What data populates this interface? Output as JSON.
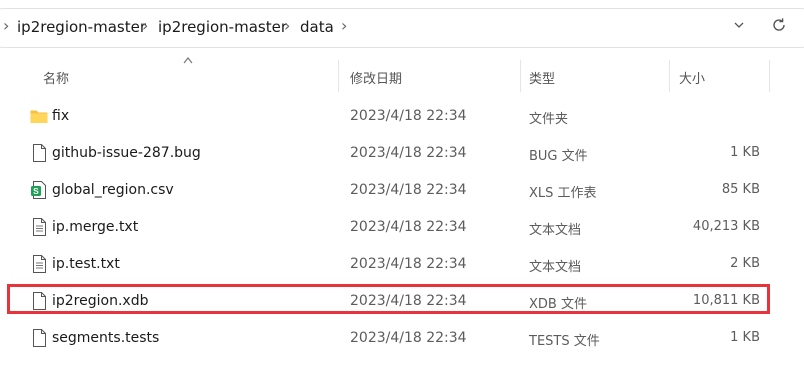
{
  "breadcrumb": [
    "ip2region-master",
    "ip2region-master",
    "data"
  ],
  "columns": {
    "name": "名称",
    "modified": "修改日期",
    "type": "类型",
    "size": "大小"
  },
  "files": [
    {
      "name": "fix",
      "modified": "2023/4/18 22:34",
      "type": "文件夹",
      "size": "",
      "icon": "folder-icon"
    },
    {
      "name": "github-issue-287.bug",
      "modified": "2023/4/18 22:34",
      "type": "BUG 文件",
      "size": "1 KB",
      "icon": "file-icon"
    },
    {
      "name": "global_region.csv",
      "modified": "2023/4/18 22:34",
      "type": "XLS 工作表",
      "size": "85 KB",
      "icon": "spreadsheet-icon"
    },
    {
      "name": "ip.merge.txt",
      "modified": "2023/4/18 22:34",
      "type": "文本文档",
      "size": "40,213 KB",
      "icon": "text-file-icon"
    },
    {
      "name": "ip.test.txt",
      "modified": "2023/4/18 22:34",
      "type": "文本文档",
      "size": "2 KB",
      "icon": "text-file-icon"
    },
    {
      "name": "ip2region.xdb",
      "modified": "2023/4/18 22:34",
      "type": "XDB 文件",
      "size": "10,811 KB",
      "icon": "file-icon"
    },
    {
      "name": "segments.tests",
      "modified": "2023/4/18 22:34",
      "type": "TESTS 文件",
      "size": "1 KB",
      "icon": "file-icon"
    }
  ],
  "highlight_color": "#e8333a"
}
